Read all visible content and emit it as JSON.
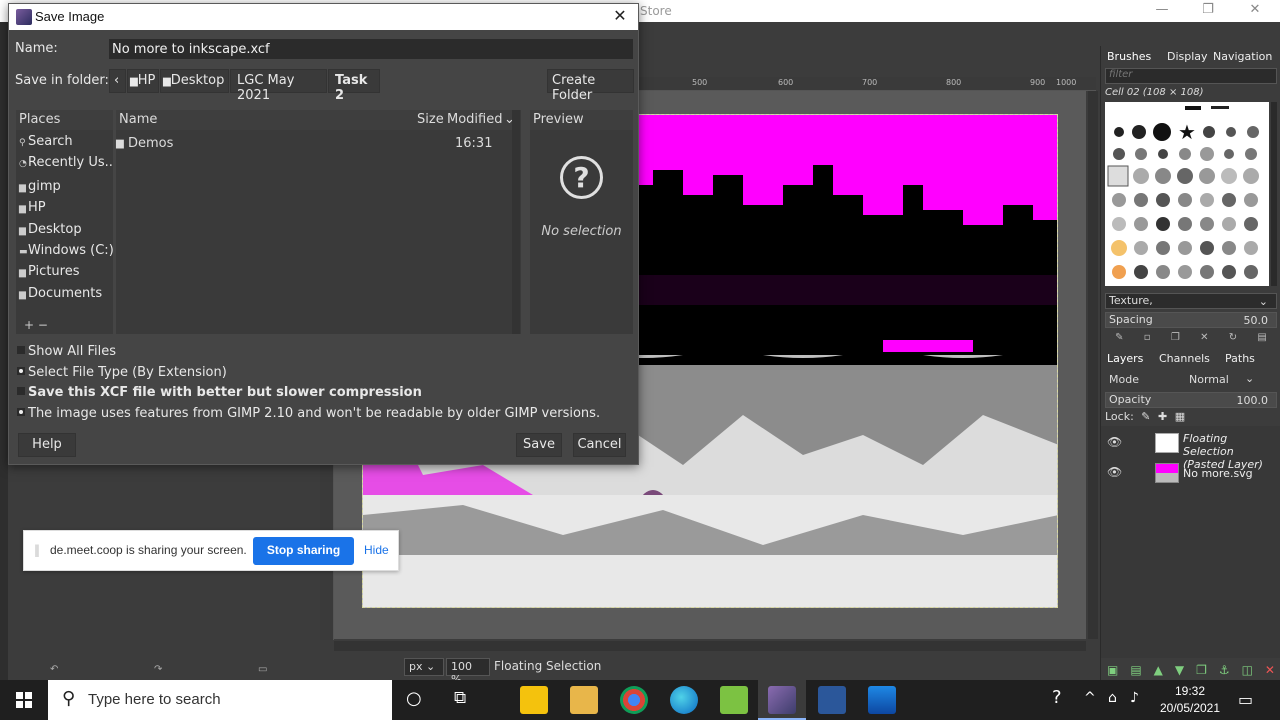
{
  "gimp": {
    "window_title_fragment": "Store",
    "ruler_ticks": [
      "500",
      "600",
      "700",
      "800",
      "900",
      "1000"
    ],
    "status": {
      "unit": "px",
      "zoom": "100 %",
      "message": "Floating Selection"
    }
  },
  "dock": {
    "brushes_tabs": [
      "Brushes",
      "Display",
      "Navigation"
    ],
    "brush_filter_placeholder": "filter",
    "brush_caption": "Cell 02 (108 × 108)",
    "brush_preset": "Texture,",
    "spacing_label": "Spacing",
    "spacing_value": "50.0",
    "layers_tabs": [
      "Layers",
      "Channels",
      "Paths"
    ],
    "mode_label": "Mode",
    "mode_value": "Normal",
    "opacity_label": "Opacity",
    "opacity_value": "100.0",
    "lock_label": "Lock:",
    "layers": [
      {
        "name_line1": "Floating Selection",
        "name_line2": "(Pasted Layer)"
      },
      {
        "name_line1": "No more.svg",
        "name_line2": ""
      }
    ]
  },
  "dialog": {
    "title": "Save Image",
    "name_label": "Name:",
    "name_value": "No more to inkscape.xcf",
    "save_in_label": "Save in folder:",
    "breadcrumbs": [
      "HP",
      "Desktop",
      "LGC May 2021",
      "Task 2"
    ],
    "create_folder": "Create Folder",
    "places_header": "Places",
    "places": [
      "Search",
      "Recently Us...",
      "gimp",
      "HP",
      "Desktop",
      "Windows (C:)",
      "Pictures",
      "Documents"
    ],
    "files_header": {
      "name": "Name",
      "size": "Size",
      "modified": "Modified"
    },
    "files": [
      {
        "name": "Demos",
        "size": "",
        "modified": "16:31"
      }
    ],
    "preview_header": "Preview",
    "preview_empty": "No selection",
    "options": {
      "show_all_files": "Show All Files",
      "select_file_type": "Select File Type (By Extension)",
      "compression": "Save this XCF file with better but slower compression",
      "compat_note": "The image uses features from GIMP 2.10 and won't be readable by older GIMP versions."
    },
    "buttons": {
      "help": "Help",
      "save": "Save",
      "cancel": "Cancel"
    }
  },
  "share_banner": {
    "text": "de.meet.coop is sharing your screen.",
    "stop": "Stop sharing",
    "hide": "Hide"
  },
  "taskbar": {
    "search_placeholder": "Type here to search",
    "time": "19:32",
    "date": "20/05/2021"
  },
  "colors": {
    "accent_blue": "#1a73e8",
    "magenta": "#ff00ff",
    "dialog_bg": "#454545"
  }
}
